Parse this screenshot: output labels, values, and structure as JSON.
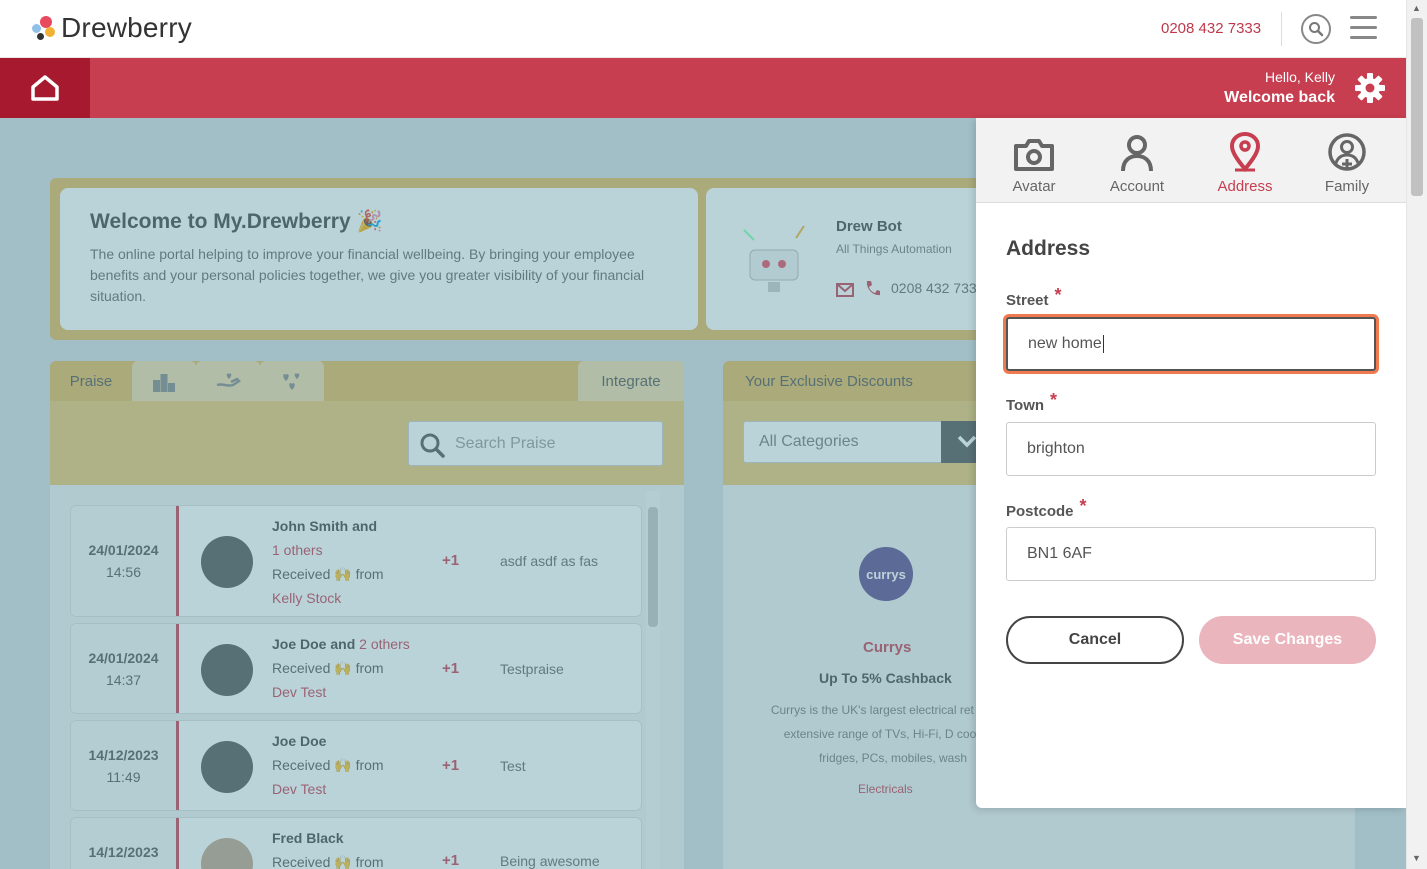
{
  "header": {
    "brand": "Drewberry",
    "phone": "0208 432 7333"
  },
  "redbar": {
    "greeting": "Hello, Kelly",
    "welcome": "Welcome back"
  },
  "welcome_card": {
    "title": "Welcome to My.Drewberry 🎉",
    "text": "The online portal helping to improve your financial wellbeing. By bringing your employee benefits and your personal policies together, we give you greater visibility of your financial situation."
  },
  "bot_card": {
    "name": "Drew Bot",
    "subtitle": "All Things Automation",
    "phone": "0208 432 733"
  },
  "praise": {
    "tab_label": "Praise",
    "integrate_label": "Integrate",
    "search_placeholder": "Search Praise",
    "rows": [
      {
        "date": "24/01/2024",
        "time": "14:56",
        "name": "John Smith and",
        "others": "1 others",
        "received": "Received",
        "from": "from",
        "sender": "Kelly Stock",
        "plus": "+1",
        "message": "asdf asdf as fas"
      },
      {
        "date": "24/01/2024",
        "time": "14:37",
        "name": "Joe Doe and",
        "others": "2 others",
        "received": "Received",
        "from": "from",
        "sender": "Dev Test",
        "plus": "+1",
        "message": "Testpraise"
      },
      {
        "date": "14/12/2023",
        "time": "11:49",
        "name": "Joe Doe",
        "others": "",
        "received": "Received",
        "from": "from",
        "sender": "Dev Test",
        "plus": "+1",
        "message": "Test"
      },
      {
        "date": "14/12/2023",
        "time": "",
        "name": "Fred Black",
        "others": "",
        "received": "Received",
        "from": "from",
        "sender": "",
        "plus": "+1",
        "message": "Being awesome"
      }
    ]
  },
  "discounts": {
    "tab_label": "Your Exclusive Discounts",
    "category": "All Categories",
    "logo_text": "currys",
    "name": "Currys",
    "offer": "Up To 5% Cashback",
    "desc": "Currys is the UK's largest electrical ret with an extensive range of TVs, Hi-Fi, D cookers, fridges, PCs, mobiles, wash",
    "category_tag": "Electricals"
  },
  "side_panel": {
    "tabs": [
      "Avatar",
      "Account",
      "Address",
      "Family"
    ],
    "active_tab": "Address",
    "title": "Address",
    "street_label": "Street",
    "street_value": "new home",
    "town_label": "Town",
    "town_value": "brighton",
    "postcode_label": "Postcode",
    "postcode_value": "BN1 6AF",
    "required_mark": "*",
    "cancel_label": "Cancel",
    "save_label": "Save Changes"
  },
  "colors": {
    "brand_red": "#c73e50",
    "dark_red": "#a6192e",
    "gold": "#e5b95d",
    "focus_orange": "#ef7a4f"
  }
}
